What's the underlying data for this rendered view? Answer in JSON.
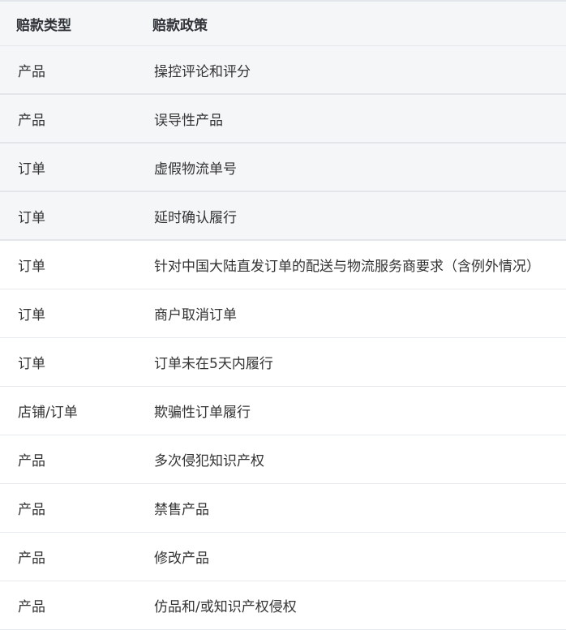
{
  "table": {
    "headers": {
      "type": "赔款类型",
      "policy": "赔款政策"
    },
    "rows": [
      {
        "type": "产品",
        "policy": "操控评论和评分"
      },
      {
        "type": "产品",
        "policy": "误导性产品"
      },
      {
        "type": "订单",
        "policy": "虚假物流单号"
      },
      {
        "type": "订单",
        "policy": "延时确认履行"
      },
      {
        "type": "订单",
        "policy": "针对中国大陆直发订单的配送与物流服务商要求（含例外情况）"
      },
      {
        "type": "订单",
        "policy": "商户取消订单"
      },
      {
        "type": "订单",
        "policy": "订单未在5天内履行"
      },
      {
        "type": "店铺/订单",
        "policy": "欺骗性订单履行"
      },
      {
        "type": "产品",
        "policy": "多次侵犯知识产权"
      },
      {
        "type": "产品",
        "policy": "禁售产品"
      },
      {
        "type": "产品",
        "policy": "修改产品"
      },
      {
        "type": "产品",
        "policy": "仿品和/或知识产权侵权"
      }
    ]
  }
}
